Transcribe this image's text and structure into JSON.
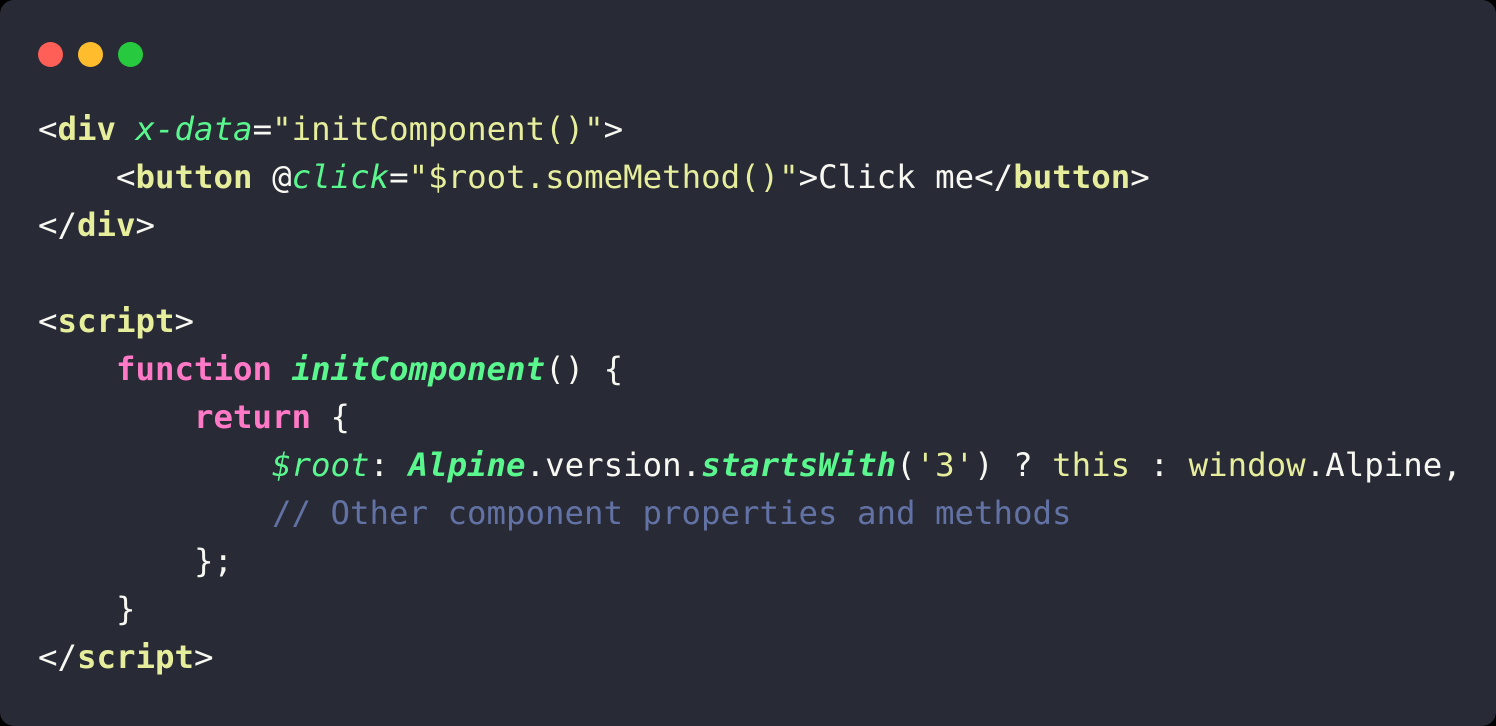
{
  "window": {
    "background_color": "#282a36",
    "corner_radius_px": 14,
    "traffic_lights": [
      {
        "name": "close",
        "color": "#ff5f56"
      },
      {
        "name": "minimize",
        "color": "#ffbd2e"
      },
      {
        "name": "maximize",
        "color": "#27c93f"
      }
    ]
  },
  "theme": {
    "foreground": "#f8f8f2",
    "tag": "#e6ee9c",
    "attribute": "#5af78e",
    "string": "#e6ee9c",
    "keyword": "#ff79c6",
    "function": "#5af78e",
    "comment": "#6272a4",
    "builtin": "#e6ee9c"
  },
  "code": {
    "language": "html",
    "plain_text": "<div x-data=\"initComponent()\">\n    <button @click=\"$root.someMethod()\">Click me</button>\n</div>\n\n<script>\n    function initComponent() {\n        return {\n            $root: Alpine.version.startsWith('3') ? this : window.Alpine,\n            // Other component properties and methods\n        };\n    }\n</script>",
    "lines": [
      {
        "index": 1,
        "tokens": [
          {
            "t": "punct",
            "v": "<"
          },
          {
            "t": "tagname",
            "v": "div"
          },
          {
            "t": "plain",
            "v": " "
          },
          {
            "t": "attr",
            "v": "x-data"
          },
          {
            "t": "punct",
            "v": "="
          },
          {
            "t": "string",
            "v": "\"initComponent()\""
          },
          {
            "t": "punct",
            "v": ">"
          }
        ]
      },
      {
        "index": 2,
        "tokens": [
          {
            "t": "plain",
            "v": "    "
          },
          {
            "t": "punct",
            "v": "<"
          },
          {
            "t": "tagname",
            "v": "button"
          },
          {
            "t": "plain",
            "v": " "
          },
          {
            "t": "at",
            "v": "@"
          },
          {
            "t": "attr",
            "v": "click"
          },
          {
            "t": "punct",
            "v": "="
          },
          {
            "t": "string",
            "v": "\"$root.someMethod()\""
          },
          {
            "t": "punct",
            "v": ">"
          },
          {
            "t": "text",
            "v": "Click me"
          },
          {
            "t": "punct",
            "v": "</"
          },
          {
            "t": "tagname",
            "v": "button"
          },
          {
            "t": "punct",
            "v": ">"
          }
        ]
      },
      {
        "index": 3,
        "tokens": [
          {
            "t": "punct",
            "v": "</"
          },
          {
            "t": "tagname",
            "v": "div"
          },
          {
            "t": "punct",
            "v": ">"
          }
        ]
      },
      {
        "index": 4,
        "tokens": []
      },
      {
        "index": 5,
        "tokens": [
          {
            "t": "punct",
            "v": "<"
          },
          {
            "t": "tagname",
            "v": "script"
          },
          {
            "t": "punct",
            "v": ">"
          }
        ]
      },
      {
        "index": 6,
        "tokens": [
          {
            "t": "plain",
            "v": "    "
          },
          {
            "t": "kw",
            "v": "function"
          },
          {
            "t": "plain",
            "v": " "
          },
          {
            "t": "fnname",
            "v": "initComponent"
          },
          {
            "t": "punct",
            "v": "() {"
          }
        ]
      },
      {
        "index": 7,
        "tokens": [
          {
            "t": "plain",
            "v": "        "
          },
          {
            "t": "kw",
            "v": "return"
          },
          {
            "t": "punct",
            "v": " {"
          }
        ]
      },
      {
        "index": 8,
        "tokens": [
          {
            "t": "plain",
            "v": "            "
          },
          {
            "t": "varname",
            "v": "$root"
          },
          {
            "t": "punct",
            "v": ": "
          },
          {
            "t": "objname",
            "v": "Alpine"
          },
          {
            "t": "punct",
            "v": ".version."
          },
          {
            "t": "method",
            "v": "startsWith"
          },
          {
            "t": "punct",
            "v": "("
          },
          {
            "t": "string",
            "v": "'3'"
          },
          {
            "t": "punct",
            "v": ") ? "
          },
          {
            "t": "builtin",
            "v": "this"
          },
          {
            "t": "punct",
            "v": " : "
          },
          {
            "t": "builtin",
            "v": "window"
          },
          {
            "t": "punct",
            "v": ".Alpine,"
          }
        ]
      },
      {
        "index": 9,
        "tokens": [
          {
            "t": "plain",
            "v": "            "
          },
          {
            "t": "comment",
            "v": "// Other component properties and methods"
          }
        ]
      },
      {
        "index": 10,
        "tokens": [
          {
            "t": "plain",
            "v": "        "
          },
          {
            "t": "punct",
            "v": "};"
          }
        ]
      },
      {
        "index": 11,
        "tokens": [
          {
            "t": "plain",
            "v": "    "
          },
          {
            "t": "punct",
            "v": "}"
          }
        ]
      },
      {
        "index": 12,
        "tokens": [
          {
            "t": "punct",
            "v": "</"
          },
          {
            "t": "tagname",
            "v": "script"
          },
          {
            "t": "punct",
            "v": ">"
          }
        ]
      }
    ]
  }
}
